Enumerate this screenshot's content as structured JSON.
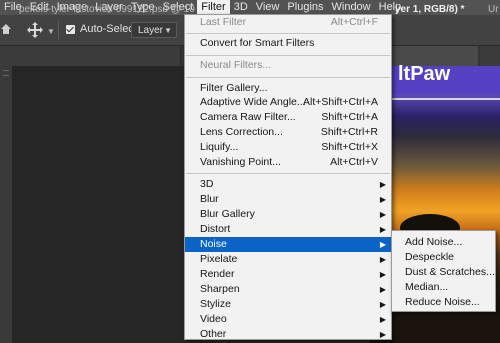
{
  "menubar": {
    "items": [
      "File",
      "Edit",
      "Image",
      "Layer",
      "Type",
      "Select",
      "Filter",
      "3D",
      "View",
      "Plugins",
      "Window",
      "Help"
    ],
    "active": "Filter"
  },
  "options": {
    "auto_select_label": "Auto-Select:",
    "auto_select_checked": true,
    "layer_select_value": "Layer"
  },
  "tabs": {
    "left": "pexels-tyler-lastovich-699122.psd @ 10",
    "right": "yer 1, RGB/8) *",
    "extra": "Ur"
  },
  "canvas": {
    "brand_text": "ltPaw"
  },
  "filter_menu": {
    "groups": [
      [
        {
          "label": "Last Filter",
          "shortcut": "Alt+Ctrl+F",
          "disabled": true
        }
      ],
      [
        {
          "label": "Convert for Smart Filters"
        }
      ],
      [
        {
          "label": "Neural Filters...",
          "disabled": true
        }
      ],
      [
        {
          "label": "Filter Gallery..."
        },
        {
          "label": "Adaptive Wide Angle...",
          "shortcut": "Alt+Shift+Ctrl+A"
        },
        {
          "label": "Camera Raw Filter...",
          "shortcut": "Shift+Ctrl+A"
        },
        {
          "label": "Lens Correction...",
          "shortcut": "Shift+Ctrl+R"
        },
        {
          "label": "Liquify...",
          "shortcut": "Shift+Ctrl+X"
        },
        {
          "label": "Vanishing Point...",
          "shortcut": "Alt+Ctrl+V"
        }
      ],
      [
        {
          "label": "3D",
          "submenu": true
        },
        {
          "label": "Blur",
          "submenu": true
        },
        {
          "label": "Blur Gallery",
          "submenu": true
        },
        {
          "label": "Distort",
          "submenu": true
        },
        {
          "label": "Noise",
          "submenu": true,
          "highlighted": true
        },
        {
          "label": "Pixelate",
          "submenu": true
        },
        {
          "label": "Render",
          "submenu": true
        },
        {
          "label": "Sharpen",
          "submenu": true
        },
        {
          "label": "Stylize",
          "submenu": true
        },
        {
          "label": "Video",
          "submenu": true
        },
        {
          "label": "Other",
          "submenu": true
        }
      ]
    ]
  },
  "noise_submenu": {
    "items": [
      "Add Noise...",
      "Despeckle",
      "Dust & Scratches...",
      "Median...",
      "Reduce Noise..."
    ]
  },
  "colors": {
    "highlight": "#0a64c8",
    "menu_bg": "#f2f2f2",
    "menubar_bg": "#535353"
  }
}
